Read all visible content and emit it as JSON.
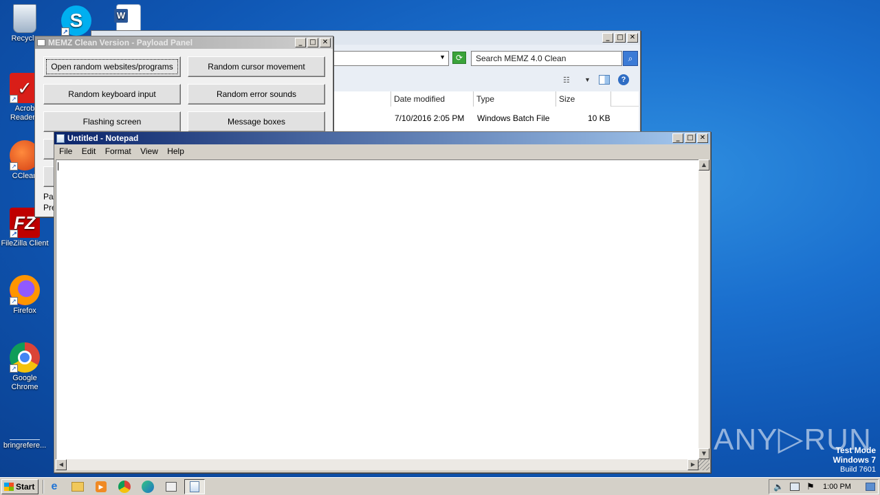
{
  "desktop": {
    "icons": [
      {
        "label": "Recycle",
        "icon": "recycle-bin-icon"
      },
      {
        "label": "Acrobat Reader DC",
        "icon": "acrobat-icon"
      },
      {
        "label": "CCleaner",
        "icon": "ccleaner-icon"
      },
      {
        "label": "FileZilla Client",
        "icon": "filezilla-icon"
      },
      {
        "label": "Firefox",
        "icon": "firefox-icon"
      },
      {
        "label": "Google Chrome",
        "icon": "chrome-icon"
      },
      {
        "label": "bringrefere...",
        "icon": "file-icon"
      }
    ],
    "acrobat_l1": "Acrob",
    "acrobat_l2": "Reader I",
    "ccleaner_label": "CClean",
    "chrome_l1": "Google",
    "chrome_l2": "Chrome",
    "watermark": {
      "brand_left": "ANY",
      "brand_right": "RUN",
      "line1": "Test Mode",
      "line2": "Windows 7",
      "line3": "Build 7601"
    }
  },
  "memz": {
    "title": "MEMZ Clean Version - Payload Panel",
    "buttons": [
      "Open random websites/programs",
      "Random cursor movement",
      "Random keyboard input",
      "Random error sounds",
      "Flashing screen",
      "Message boxes"
    ],
    "footer_l1": "Pa",
    "footer_l2": "Pre"
  },
  "explorer": {
    "search_placeholder": "Search MEMZ 4.0 Clean",
    "columns": [
      "Date modified",
      "Type",
      "Size"
    ],
    "row": {
      "date": "7/10/2016 2:05 PM",
      "type": "Windows Batch File",
      "size": "10 KB"
    }
  },
  "notepad": {
    "title": "Untitled - Notepad",
    "menu": [
      "File",
      "Edit",
      "Format",
      "View",
      "Help"
    ],
    "content": ""
  },
  "taskbar": {
    "start_label": "Start",
    "clock": "1:00 PM"
  },
  "colors": {
    "desktop_blue": "#1a6fce",
    "notepad_title_active": "#0a246a",
    "window_face": "#d4d0c8"
  }
}
